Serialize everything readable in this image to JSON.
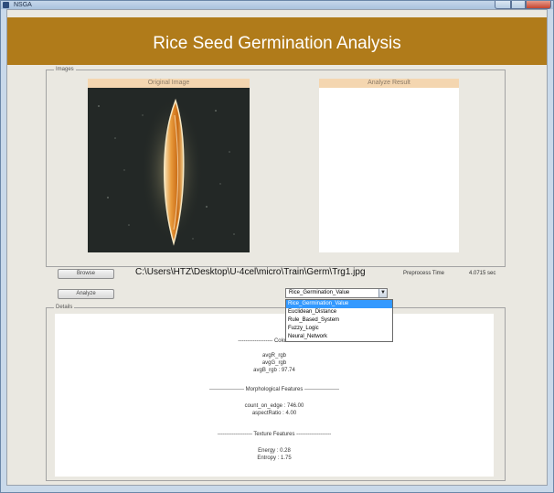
{
  "window": {
    "title": "NSGA"
  },
  "banner": {
    "title": "Rice Seed Germination Analysis",
    "color": "#b07b1a"
  },
  "images_panel": {
    "legend": "Images",
    "original_label": "Original Image",
    "result_label": "Analyze Result"
  },
  "controls": {
    "browse_label": "Browse",
    "analyze_label": "Analyze",
    "path": "C:\\Users\\HTZ\\Desktop\\U-4cel\\micro\\Train\\Germ\\Trg1.jpg",
    "preprocess_label": "Preprocess Time",
    "preprocess_value": "4.0715 sec"
  },
  "method_select": {
    "selected": "Rice_Germination_Value",
    "options": [
      "Rice_Germination_Value",
      "Euclidean_Distance",
      "Rule_Based_System",
      "Fuzzy_Logic",
      "Neural_Network"
    ]
  },
  "details": {
    "legend": "Details",
    "color_header": "------------------- Color Features",
    "color_rows": [
      "avgR_rgb",
      "avgG_rgb",
      "avgB_rgb : 97.74"
    ],
    "morph_header": "------------------- Morphological Features -------------------",
    "morph_rows": [
      "count_on_edge : 746.00",
      "aspectRatio : 4.00"
    ],
    "texture_header": "------------------- Texture Features -------------------",
    "texture_rows": [
      "Energy : 0.28",
      "Entropy : 1.75"
    ]
  }
}
